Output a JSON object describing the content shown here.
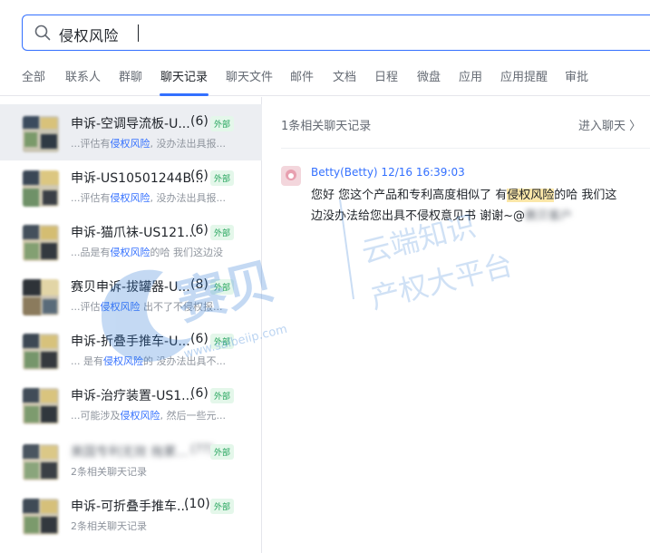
{
  "search": {
    "query": "侵权风险"
  },
  "tabs": [
    "全部",
    "联系人",
    "群聊",
    "聊天记录",
    "聊天文件",
    "邮件",
    "文档",
    "日程",
    "微盘",
    "应用",
    "应用提醒",
    "审批"
  ],
  "results": [
    {
      "title": "申诉-空调导流板-U...",
      "count": "(6)",
      "tag": "外部",
      "pre": "...评估有",
      "hl": "侵权风险",
      "post": ", 没办法出具报..."
    },
    {
      "title": "申诉-US10501244B...",
      "count": "(6)",
      "tag": "外部",
      "pre": "...评估有",
      "hl": "侵权风险",
      "post": ", 没办法出具报..."
    },
    {
      "title": "申诉-猫爪袜-US121...",
      "count": "(6)",
      "tag": "外部",
      "pre": "...品是有",
      "hl": "侵权风险",
      "post": "的哈 我们这边没"
    },
    {
      "title": "赛贝申诉-拔罐器-U...",
      "count": "(8)",
      "tag": "外部",
      "pre": "...评估",
      "hl": "侵权风险",
      "post": " 出不了不侵权报..."
    },
    {
      "title": "申诉-折叠手推车-U...",
      "count": "(6)",
      "tag": "外部",
      "pre": "... 是有",
      "hl": "侵权风险",
      "post": "的 没办法出具不..."
    },
    {
      "title": "申诉-治疗装置-US1...",
      "count": "(6)",
      "tag": "外部",
      "pre": "...可能涉及",
      "hl": "侵权风险",
      "post": ", 然后一些元..."
    },
    {
      "title": "美国专利无效 拖累...",
      "count": "(??)",
      "tag": "外部",
      "pre": "2条相关聊天记录",
      "hl": "",
      "post": ""
    },
    {
      "title": "申诉-可折叠手推车...",
      "count": "(10)",
      "tag": "外部",
      "pre": "2条相关聊天记录",
      "hl": "",
      "post": ""
    }
  ],
  "detail": {
    "count_text": "1条相关聊天记录",
    "enter_chat": "进入聊天 〉",
    "sender": "Betty(Betty)  12/16 16:39:03",
    "message_pre": "您好 您这个产品和专利高度相似了 有",
    "message_hl": "侵权风险",
    "message_post": "的哈 我们这边没办法给您出具不侵权意见书 谢谢~@",
    "mention": "赛贝客户"
  },
  "watermark": {
    "brand": "赛贝",
    "url": "www.saibeiip.com",
    "slogan_1": "云端知识",
    "slogan_2": "产权大平台"
  }
}
